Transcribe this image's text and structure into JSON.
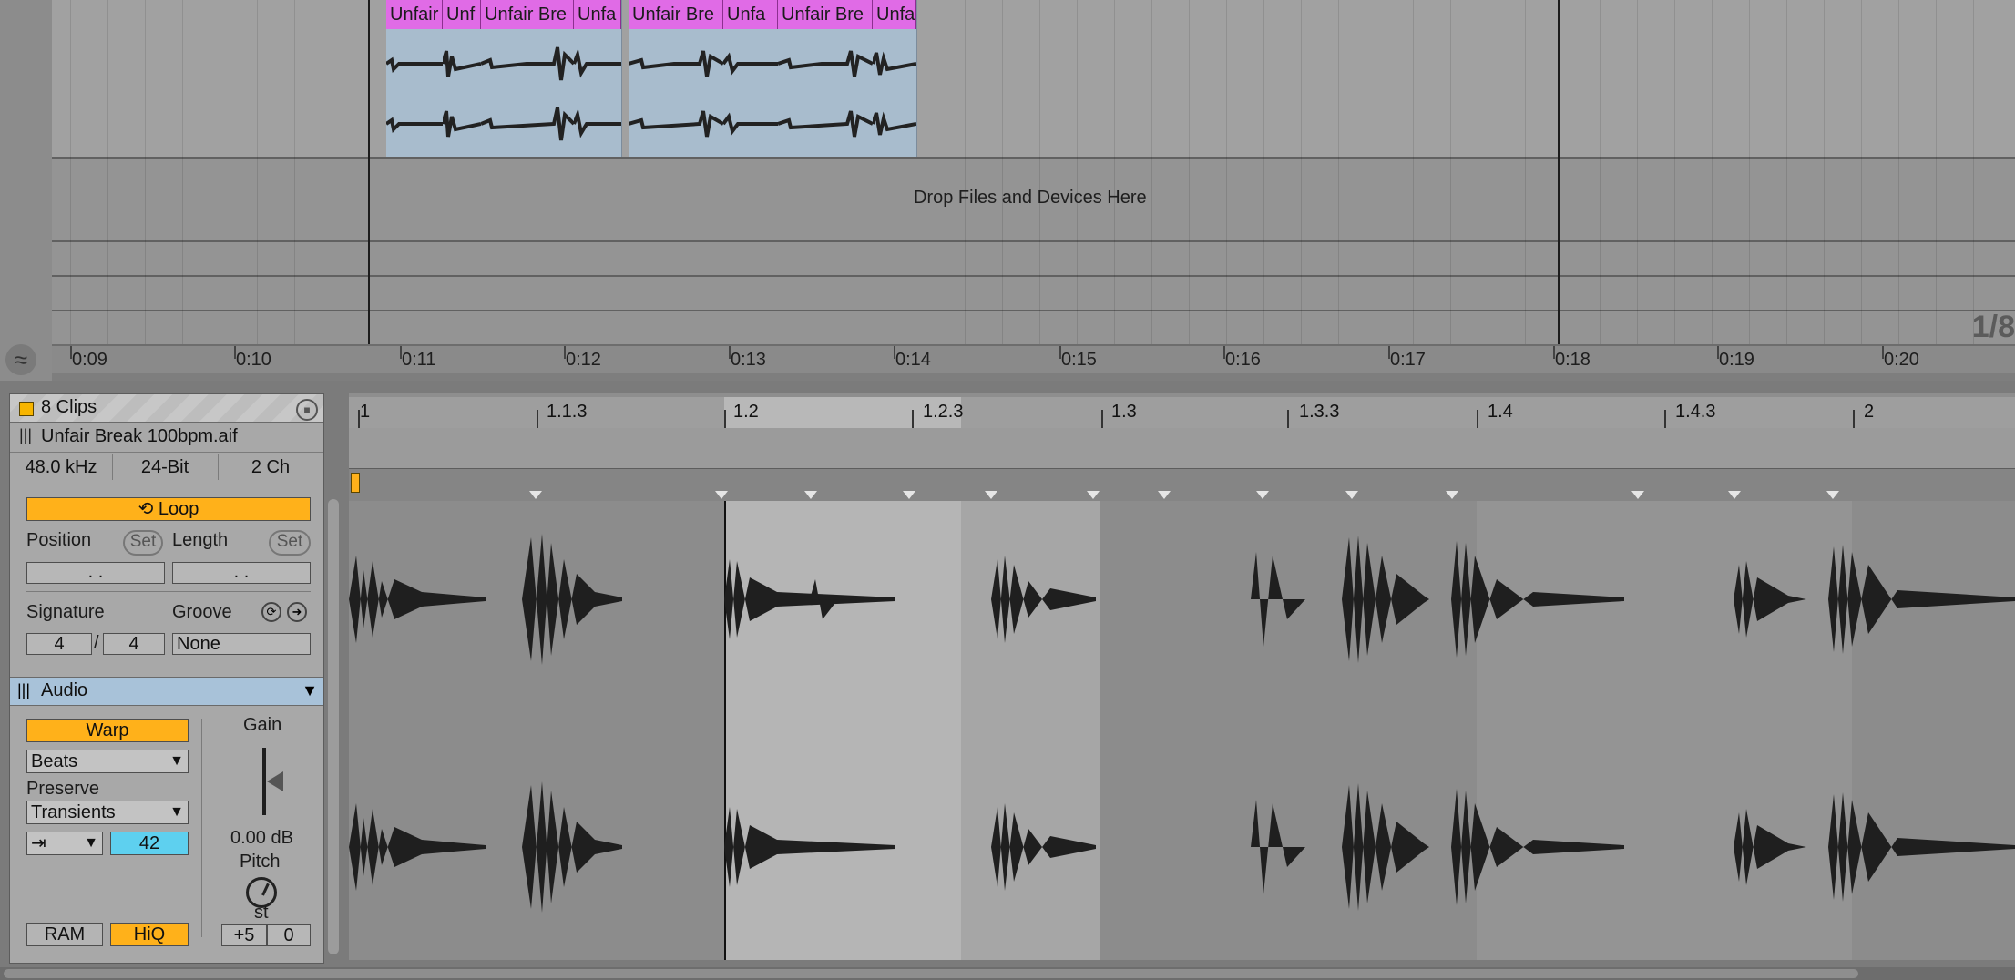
{
  "arrangement": {
    "drop_text": "Drop Files and Devices Here",
    "zoom_label": "1/8",
    "time_ticks": [
      "0:09",
      "0:10",
      "0:11",
      "0:12",
      "0:13",
      "0:14",
      "0:15",
      "0:16",
      "0:17",
      "0:18",
      "0:19",
      "0:20"
    ],
    "clips": [
      "Unfair",
      "Unf",
      "Unfair Bre",
      "Unfa",
      "Unfair Bre",
      "Unfa",
      "Unfair Bre",
      "Unfa"
    ]
  },
  "clip_panel": {
    "title": "8 Clips",
    "file_name": "Unfair Break 100bpm.aif",
    "sample_rate": "48.0 kHz",
    "bit_depth": "24-Bit",
    "channels": "2 Ch",
    "loop_label": "Loop",
    "position_label": "Position",
    "length_label": "Length",
    "set_label": "Set",
    "position_value": ". .",
    "length_value": ". .",
    "signature_label": "Signature",
    "groove_label": "Groove",
    "sig_num": "4",
    "sig_sep": "/",
    "sig_den": "4",
    "groove_value": "None",
    "colors": {
      "accent": "#ffb11a",
      "clip": "#e06be6",
      "audio_header": "#a8c2d9"
    }
  },
  "audio_panel": {
    "title": "Audio",
    "warp_label": "Warp",
    "warp_mode": "Beats",
    "preserve_label": "Preserve",
    "preserve_value": "Transients",
    "envelope_value": "42",
    "gain_label": "Gain",
    "gain_value": "0.00 dB",
    "pitch_label": "Pitch",
    "pitch_unit": "st",
    "pitch_semitones": "+5",
    "pitch_cents": "0",
    "ram_label": "RAM",
    "hiq_label": "HiQ"
  },
  "sample_editor": {
    "ruler_ticks": [
      "1",
      "1.1.3",
      "1.2",
      "1.2.3",
      "1.3",
      "1.3.3",
      "1.4",
      "1.4.3",
      "2"
    ]
  }
}
